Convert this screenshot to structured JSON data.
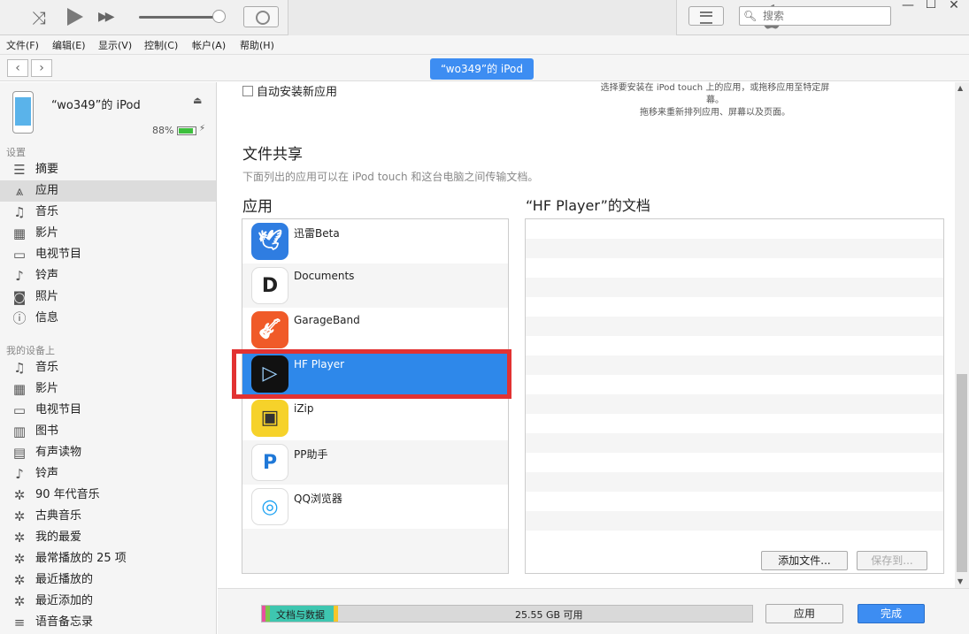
{
  "toolbar": {
    "search_placeholder": "搜索",
    "shuffle_icon": "shuffle-icon",
    "play_icon": "play-icon",
    "fast_forward_icon": "fast-forward-icon",
    "airplay_icon": "airplay-icon",
    "apple_icon": "apple-logo-icon",
    "list_icon": "list-view-icon",
    "window_controls": [
      "—",
      "☐",
      "✕"
    ]
  },
  "menubar": [
    "文件(F)",
    "编辑(E)",
    "显示(V)",
    "控制(C)",
    "帐户(A)",
    "帮助(H)"
  ],
  "navbar": {
    "back": "‹",
    "forward": "›",
    "device_pill": "“wo349”的 iPod"
  },
  "sidebar": {
    "device_name": "“wo349”的 iPod",
    "battery_text": "88%",
    "battery_level": 0.88,
    "battery_color": "#3dbf3d",
    "settings_header": "设置",
    "settings_items": [
      {
        "label": "摘要",
        "icon": "summary-icon",
        "glyph": "☰"
      },
      {
        "label": "应用",
        "icon": "apps-icon",
        "glyph": "⩓"
      },
      {
        "label": "音乐",
        "icon": "music-icon",
        "glyph": "♫"
      },
      {
        "label": "影片",
        "icon": "film-icon",
        "glyph": "▦"
      },
      {
        "label": "电视节目",
        "icon": "tv-icon",
        "glyph": "▭"
      },
      {
        "label": "铃声",
        "icon": "bell-icon",
        "glyph": "♪"
      },
      {
        "label": "照片",
        "icon": "camera-icon",
        "glyph": "◙"
      },
      {
        "label": "信息",
        "icon": "info-icon",
        "glyph": "ⓘ"
      }
    ],
    "ondevice_header": "我的设备上",
    "ondevice_items": [
      {
        "label": "音乐",
        "icon": "music-icon",
        "glyph": "♫"
      },
      {
        "label": "影片",
        "icon": "film-icon",
        "glyph": "▦"
      },
      {
        "label": "电视节目",
        "icon": "tv-icon",
        "glyph": "▭"
      },
      {
        "label": "图书",
        "icon": "book-icon",
        "glyph": "▥"
      },
      {
        "label": "有声读物",
        "icon": "audiobook-icon",
        "glyph": "▤"
      },
      {
        "label": "铃声",
        "icon": "bell-icon",
        "glyph": "♪"
      },
      {
        "label": "90 年代音乐",
        "icon": "smart-playlist-icon",
        "glyph": "✲"
      },
      {
        "label": "古典音乐",
        "icon": "smart-playlist-icon",
        "glyph": "✲"
      },
      {
        "label": "我的最爱",
        "icon": "smart-playlist-icon",
        "glyph": "✲"
      },
      {
        "label": "最常播放的 25 项",
        "icon": "smart-playlist-icon",
        "glyph": "✲"
      },
      {
        "label": "最近播放的",
        "icon": "smart-playlist-icon",
        "glyph": "✲"
      },
      {
        "label": "最近添加的",
        "icon": "smart-playlist-icon",
        "glyph": "✲"
      },
      {
        "label": "语音备忘录",
        "icon": "playlist-icon",
        "glyph": "≡"
      }
    ]
  },
  "main": {
    "auto_install_label": "自动安装新应用",
    "top_note_line1": "选择要安装在 iPod touch 上的应用，或拖移应用至特定屏幕。",
    "top_note_line2": "拖移来重新排列应用、屏幕以及页面。",
    "file_sharing_title": "文件共享",
    "file_sharing_desc": "下面列出的应用可以在 iPod touch 和这台电脑之间传输文档。",
    "apps_title": "应用",
    "docs_title": "“HF Player”的文档",
    "apps": [
      {
        "name": "迅雷Beta",
        "icon": "xunlei-icon",
        "color": "#2f7de1",
        "selected": false
      },
      {
        "name": "Documents",
        "icon": "documents-icon",
        "color": "#ffffff",
        "selected": false
      },
      {
        "name": "GarageBand",
        "icon": "garageband-icon",
        "color": "#f05a28",
        "selected": false
      },
      {
        "name": "HF Player",
        "icon": "hf-player-icon",
        "color": "#111111",
        "selected": true
      },
      {
        "name": "iZip",
        "icon": "izip-icon",
        "color": "#f6d22a",
        "selected": false
      },
      {
        "name": "PP助手",
        "icon": "pp-helper-icon",
        "color": "#ffffff",
        "selected": false
      },
      {
        "name": "QQ浏览器",
        "icon": "qq-browser-icon",
        "color": "#ffffff",
        "selected": false
      }
    ],
    "add_file_button": "添加文件...",
    "save_to_button": "保存到..."
  },
  "bottom": {
    "docs_segment_label": "文档与数据",
    "free_label": "25.55 GB 可用",
    "apply_button": "应用",
    "done_button": "完成",
    "segment_colors": [
      "#e84fa0",
      "#7ec64a",
      "#3ec6b0",
      "#f6c62a"
    ],
    "accent": "#3d8df2"
  }
}
